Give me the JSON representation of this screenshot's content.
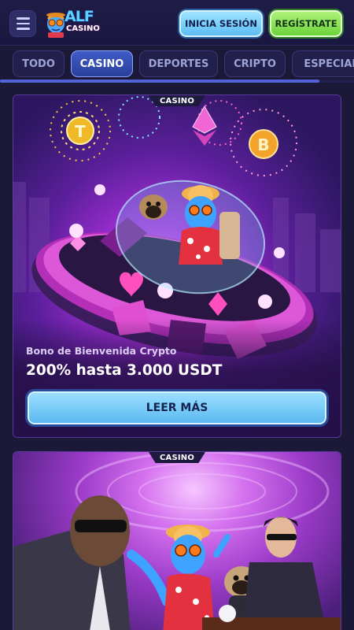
{
  "header": {
    "logo_word": "ALF",
    "logo_sub": "CASINO",
    "login_label": "INICIA SESIÓN",
    "register_label": "REGÍSTRATE"
  },
  "tabs": [
    {
      "label": "TODO",
      "active": false
    },
    {
      "label": "CASINO",
      "active": true
    },
    {
      "label": "DEPORTES",
      "active": false
    },
    {
      "label": "CRIPTO",
      "active": false
    },
    {
      "label": "ESPECIAL",
      "active": false
    }
  ],
  "promos": [
    {
      "badge": "CASINO",
      "subtitle": "Bono de Bienvenida Crypto",
      "title": "200% hasta 3.000 USDT",
      "button_label": "LEER MÁS"
    },
    {
      "badge": "CASINO"
    }
  ],
  "colors": {
    "background": "#1b1838",
    "accent_blue": "#5cb9f0",
    "accent_green": "#6bd23b",
    "active_tab": "#2a3f9a"
  },
  "icons": [
    "menu-icon",
    "tether-icon",
    "ethereum-icon",
    "bitcoin-icon",
    "heart-icon",
    "diamond-icon"
  ]
}
